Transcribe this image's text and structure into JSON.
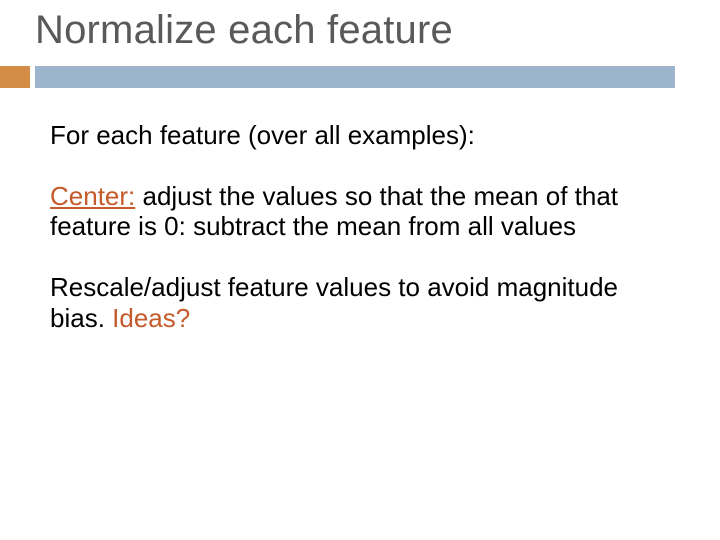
{
  "slide": {
    "title": "Normalize each feature",
    "para1": "For each feature (over all examples):",
    "center_label": "Center:",
    "center_text": "  adjust the values so that the mean of that feature is 0: subtract the mean from all values",
    "rescale_prefix": "Rescale/adjust feature values to avoid magnitude bias.  ",
    "ideas": "Ideas?"
  }
}
